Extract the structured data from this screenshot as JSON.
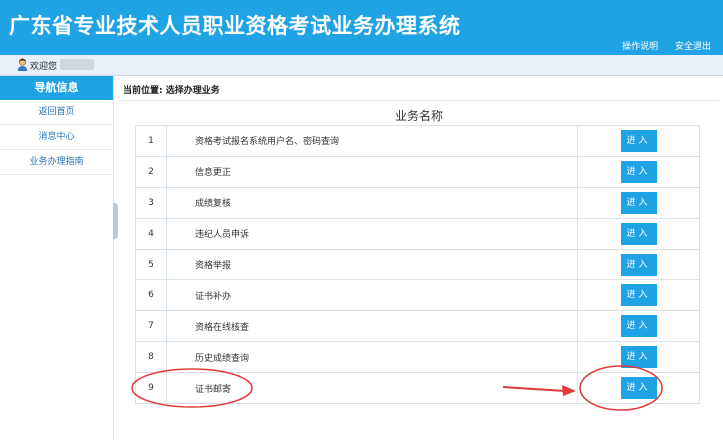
{
  "header": {
    "title": "广东省专业技术人员职业资格考试业务办理系统",
    "links": [
      "操作说明",
      "安全退出"
    ]
  },
  "welcome": {
    "text": "欢迎您"
  },
  "sidebar": {
    "title": "导航信息",
    "items": [
      {
        "label": "返回首页"
      },
      {
        "label": "消息中心"
      },
      {
        "label": "业务办理指南"
      }
    ]
  },
  "breadcrumb": "当前位置: 选择办理业务",
  "table": {
    "title": "业务名称",
    "button_label": "进入",
    "rows": [
      {
        "num": "1",
        "name": "资格考试报名系统用户名、密码查询"
      },
      {
        "num": "2",
        "name": "信息更正"
      },
      {
        "num": "3",
        "name": "成绩复核"
      },
      {
        "num": "4",
        "name": "违纪人员申诉"
      },
      {
        "num": "5",
        "name": "资格举报"
      },
      {
        "num": "6",
        "name": "证书补办"
      },
      {
        "num": "7",
        "name": "资格在线核查"
      },
      {
        "num": "8",
        "name": "历史成绩查询"
      },
      {
        "num": "9",
        "name": "证书邮寄"
      }
    ]
  },
  "colors": {
    "brand_blue": "#1fa3e4",
    "annotation_red": "#e03a3a"
  }
}
